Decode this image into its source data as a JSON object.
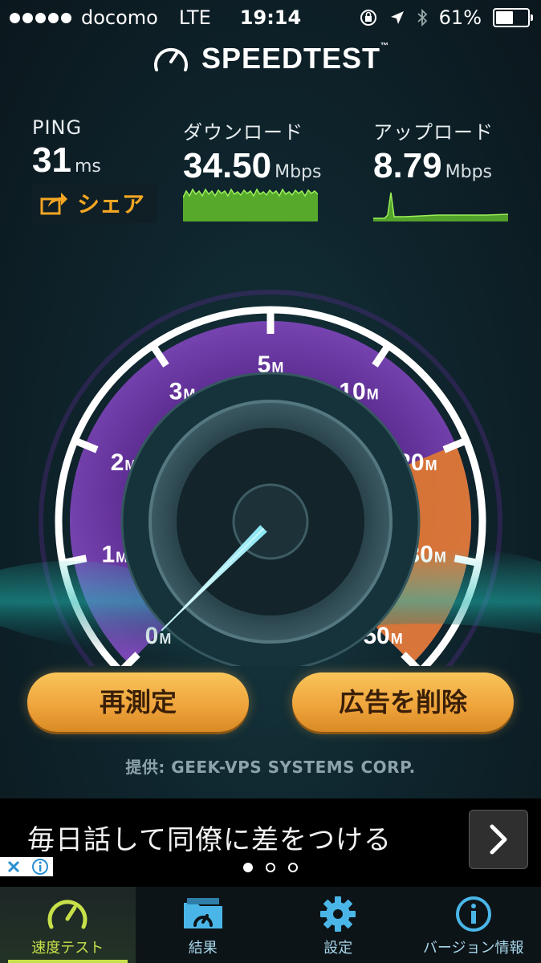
{
  "status_bar": {
    "carrier": "docomo",
    "network": "LTE",
    "time": "19:14",
    "battery": "61%",
    "battery_level": 0.61
  },
  "header": {
    "logo_text": "SPEEDTEST",
    "trademark": "™"
  },
  "results": {
    "ping": {
      "label": "PING",
      "value": "31",
      "unit": "ms"
    },
    "download": {
      "label": "ダウンロード",
      "value": "34.50",
      "unit": "Mbps"
    },
    "upload": {
      "label": "アップロード",
      "value": "8.79",
      "unit": "Mbps"
    }
  },
  "share": {
    "label": "シェア"
  },
  "gauge": {
    "ticks": [
      {
        "num": "0",
        "unit": "M"
      },
      {
        "num": "1",
        "unit": "M"
      },
      {
        "num": "2",
        "unit": "M"
      },
      {
        "num": "3",
        "unit": "M"
      },
      {
        "num": "5",
        "unit": "M"
      },
      {
        "num": "10",
        "unit": "M"
      },
      {
        "num": "20",
        "unit": "M"
      },
      {
        "num": "30",
        "unit": "M"
      },
      {
        "num": "50",
        "unit": "M"
      }
    ],
    "needle_value_mbps": 0,
    "colors": {
      "ring": "#ffffff",
      "inner": "#5b2b8f",
      "hot": "#e07a30",
      "needle": "#8ef0ff"
    }
  },
  "buttons": {
    "retest": "再測定",
    "remove_ads": "広告を削除"
  },
  "provider": "提供: GEEK-VPS SYSTEMS CORP.",
  "ad": {
    "text": "毎日話して同僚に差をつける",
    "pages": 3,
    "active_page": 0
  },
  "tabs": [
    {
      "label": "速度テスト",
      "icon": "speedometer-icon",
      "active": true
    },
    {
      "label": "結果",
      "icon": "results-folder-icon",
      "active": false
    },
    {
      "label": "設定",
      "icon": "gear-icon",
      "active": false
    },
    {
      "label": "バージョン情報",
      "icon": "info-icon",
      "active": false
    }
  ],
  "colors": {
    "accent": "#f5a623",
    "tab_active": "#c7e04a",
    "tab_inactive": "#a7d6ea",
    "graph": "#7ddc3a"
  }
}
